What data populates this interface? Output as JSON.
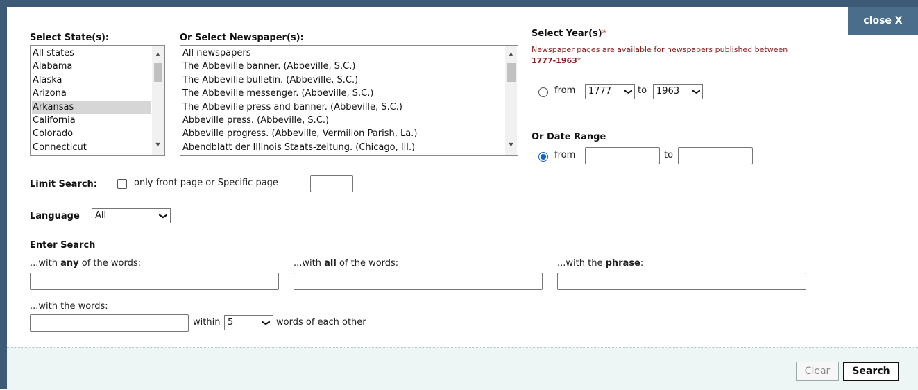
{
  "close_label": "close  X",
  "states": {
    "label": "Select State(s):",
    "items": [
      "All states",
      "Alabama",
      "Alaska",
      "Arizona",
      "Arkansas",
      "California",
      "Colorado",
      "Connecticut"
    ],
    "selected": "Arkansas"
  },
  "newspapers": {
    "label": "Or Select Newspaper(s):",
    "items": [
      "All newspapers",
      "The Abbeville banner. (Abbeville, S.C.)",
      "The Abbeville bulletin. (Abbeville, S.C.)",
      "The Abbeville messenger. (Abbeville, S.C.)",
      "The Abbeville press and banner. (Abbeville, S.C.)",
      "Abbeville press. (Abbeville, S.C.)",
      "Abbeville progress. (Abbeville, Vermilion Parish, La.)",
      "Abendblatt der Illinois Staats-zeitung. (Chicago, Ill.)"
    ]
  },
  "years": {
    "label": "Select Year(s)",
    "required_mark": "*",
    "note": "Newspaper pages are available for newspapers published between",
    "range_text": "1777-1963",
    "from_label": "from",
    "to_label": "to",
    "from_value": "1777",
    "to_value": "1963"
  },
  "date_range": {
    "label": "Or Date Range",
    "from_label": "from",
    "to_label": "to",
    "from_value": "",
    "to_value": ""
  },
  "limit": {
    "label": "Limit Search:",
    "text": "only front page or Specific page",
    "page_value": ""
  },
  "language": {
    "label": "Language",
    "value": "All"
  },
  "search_terms": {
    "heading": "Enter Search",
    "any_prefix": "...with ",
    "any_bold": "any",
    "any_suffix": " of the words:",
    "all_prefix": "...with ",
    "all_bold": "all",
    "all_suffix": " of the words:",
    "phrase_prefix": "...with the ",
    "phrase_bold": "phrase",
    "phrase_suffix": ":",
    "proximity_label": "...with the words:",
    "within_label": "within",
    "within_value": "5",
    "words_suffix": "words of each other"
  },
  "buttons": {
    "clear": "Clear",
    "search": "Search"
  }
}
